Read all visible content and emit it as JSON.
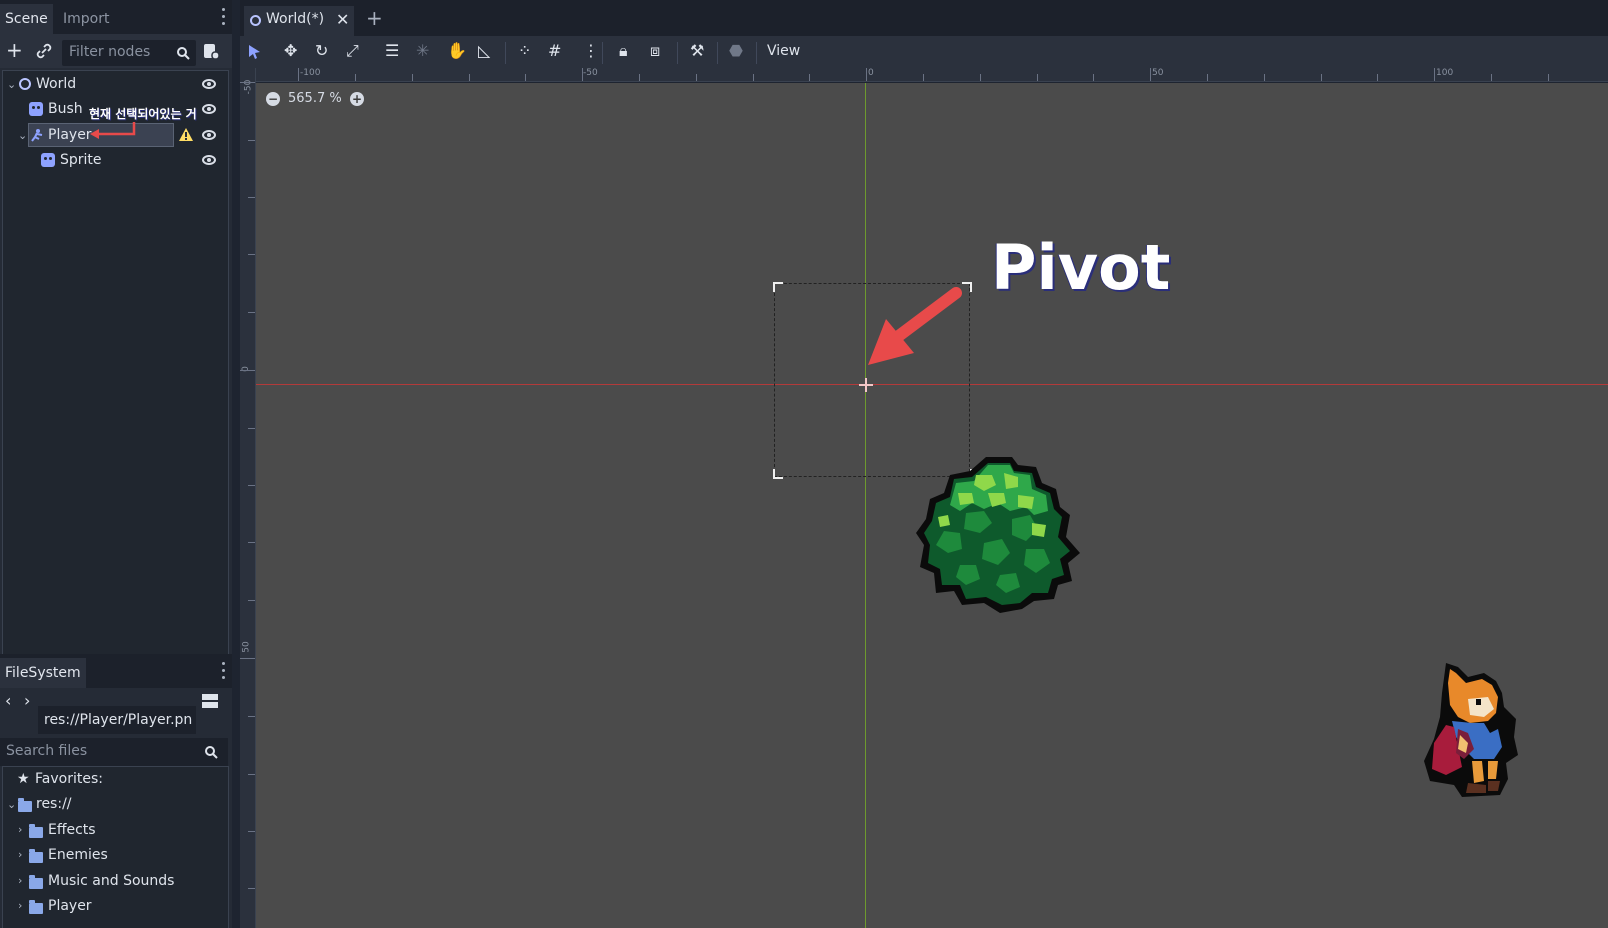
{
  "left_dock": {
    "tabs": [
      "Scene",
      "Import"
    ],
    "filter_placeholder": "Filter nodes",
    "tree": [
      {
        "label": "World",
        "icon": "node2d-circle-icon"
      },
      {
        "label": "Bush",
        "icon": "sprite-icon"
      },
      {
        "label": "Player",
        "icon": "kinematic-body-icon",
        "warning": true
      },
      {
        "label": "Sprite",
        "icon": "sprite-icon"
      }
    ],
    "annotation": "현재 선택되어있는 거"
  },
  "filesystem": {
    "tab": "FileSystem",
    "path": "res://Player/Player.pn",
    "search_placeholder": "Search files",
    "favorites": "Favorites:",
    "root": "res://",
    "folders": [
      "Effects",
      "Enemies",
      "Music and Sounds",
      "Player"
    ]
  },
  "main": {
    "scene_tab": "World(*)",
    "view_menu": "View",
    "zoom": "565.7 %",
    "ruler_top": [
      "-100",
      "-50",
      "0",
      "50",
      "100"
    ],
    "ruler_left": [
      "-50",
      "0",
      "50"
    ],
    "pivot_label": "Pivot"
  },
  "colors": {
    "accent": "#8ea2ff",
    "x_axis": "#b33a3a",
    "y_axis": "#6e9a2e",
    "annotation_arrow": "#e84a4a"
  }
}
